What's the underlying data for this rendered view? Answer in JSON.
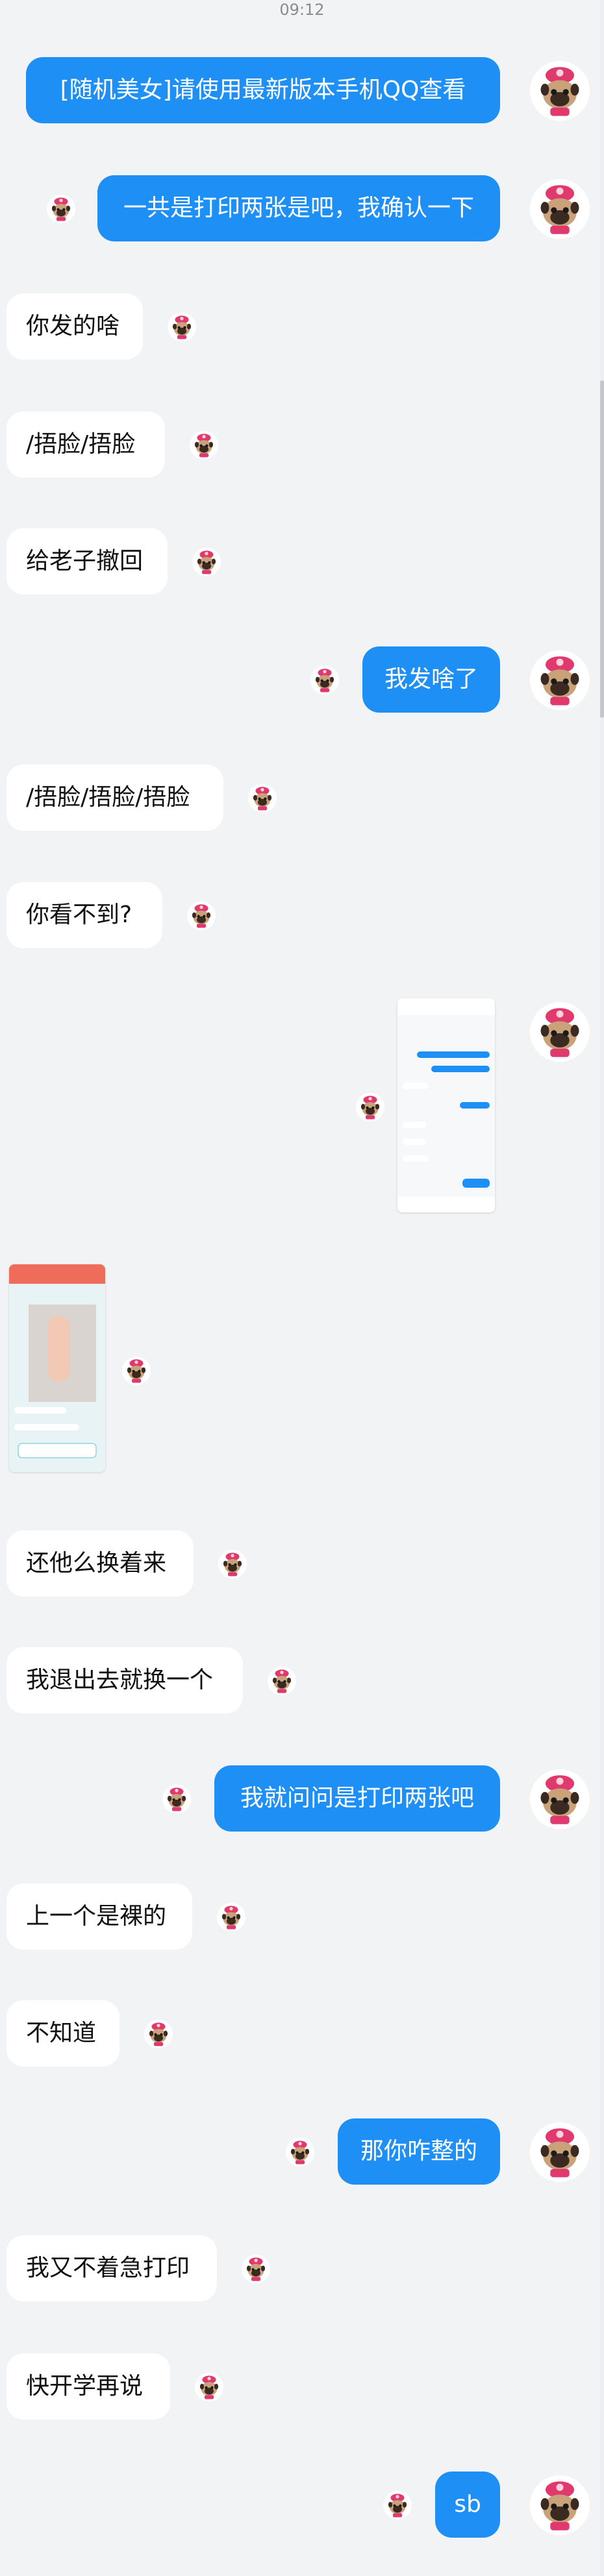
{
  "status": {
    "time": "09:12"
  },
  "messages": [
    {
      "side": "out",
      "text": "[随机美女]请使用最新版本手机QQ查看"
    },
    {
      "side": "out",
      "text": "一共是打印两张是吧，我确认一下"
    },
    {
      "side": "in",
      "text": "你发的啥"
    },
    {
      "side": "in",
      "text": "/捂脸/捂脸"
    },
    {
      "side": "in",
      "text": "给老子撤回"
    },
    {
      "side": "out",
      "text": "我发啥了"
    },
    {
      "side": "in",
      "text": "/捂脸/捂脸/捂脸"
    },
    {
      "side": "in",
      "text": "你看不到?"
    },
    {
      "side": "out",
      "kind": "screenshot"
    },
    {
      "side": "in",
      "kind": "photo"
    },
    {
      "side": "in",
      "text": "还他么换着来"
    },
    {
      "side": "in",
      "text": "我退出去就换一个"
    },
    {
      "side": "out",
      "text": "我就问问是打印两张吧"
    },
    {
      "side": "in",
      "text": "上一个是裸的"
    },
    {
      "side": "in",
      "text": "不知道"
    },
    {
      "side": "out",
      "text": "那你咋整的"
    },
    {
      "side": "in",
      "text": "我又不着急打印"
    },
    {
      "side": "in",
      "text": "快开学再说"
    },
    {
      "side": "out",
      "text": "sb"
    }
  ],
  "colors": {
    "background": "#f2f3f5",
    "outgoing_bubble": "#1e8ff5",
    "incoming_bubble": "#ffffff"
  }
}
